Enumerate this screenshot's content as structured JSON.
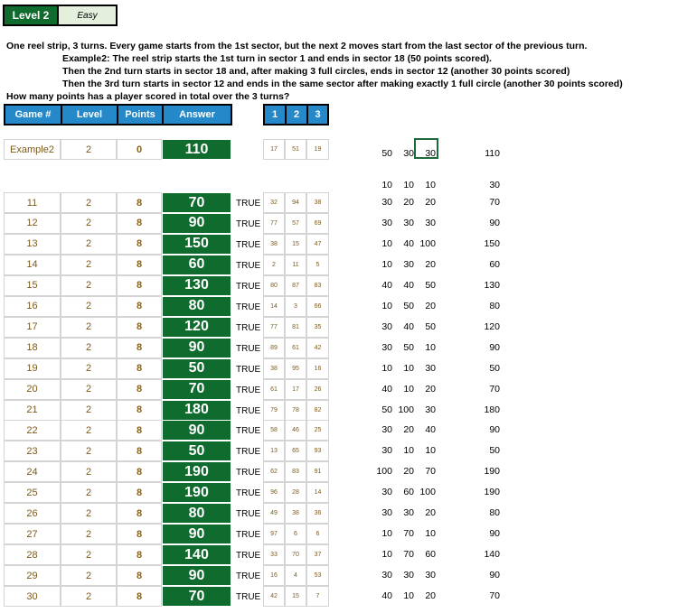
{
  "level": "Level 2",
  "difficulty": "Easy",
  "description": [
    "One reel strip, 3 turns. Every game starts from the 1st sector, but the next 2 moves start from the last sector of the previous turn.",
    "Example2: The reel strip starts the 1st turn in sector 1 and ends in sector 18 (50 points scored).",
    "Then the 2nd turn starts in sector 18 and, after making 3 full circles, ends in sector 12 (another 30 points scored)",
    "Then the 3rd turn starts in sector 12 and ends in the same sector after making exactly 1 full circle (another 30 points scored)",
    "How many points has a player scored in total over the 3 turns?"
  ],
  "headers": {
    "game": "Game #",
    "level": "Level",
    "points": "Points",
    "answer": "Answer",
    "s1": "1",
    "s2": "2",
    "s3": "3"
  },
  "example": {
    "game": "Example2",
    "level": "2",
    "points": "0",
    "answer": "110",
    "sectors": [
      "17",
      "51",
      "19"
    ],
    "calc": [
      "50",
      "30",
      "30"
    ],
    "total": "110"
  },
  "example_sub": {
    "calc": [
      "10",
      "10",
      "10"
    ],
    "total": "30"
  },
  "rows": [
    {
      "game": "11",
      "level": "2",
      "points": "8",
      "answer": "70",
      "check": "TRUE",
      "sectors": [
        "32",
        "94",
        "38"
      ],
      "calc": [
        "30",
        "20",
        "20"
      ],
      "total": "70"
    },
    {
      "game": "12",
      "level": "2",
      "points": "8",
      "answer": "90",
      "check": "TRUE",
      "sectors": [
        "77",
        "57",
        "69"
      ],
      "calc": [
        "30",
        "30",
        "30"
      ],
      "total": "90"
    },
    {
      "game": "13",
      "level": "2",
      "points": "8",
      "answer": "150",
      "check": "TRUE",
      "sectors": [
        "38",
        "15",
        "47"
      ],
      "calc": [
        "10",
        "40",
        "100"
      ],
      "total": "150"
    },
    {
      "game": "14",
      "level": "2",
      "points": "8",
      "answer": "60",
      "check": "TRUE",
      "sectors": [
        "2",
        "11",
        "5"
      ],
      "calc": [
        "10",
        "30",
        "20"
      ],
      "total": "60"
    },
    {
      "game": "15",
      "level": "2",
      "points": "8",
      "answer": "130",
      "check": "TRUE",
      "sectors": [
        "80",
        "87",
        "83"
      ],
      "calc": [
        "40",
        "40",
        "50"
      ],
      "total": "130"
    },
    {
      "game": "16",
      "level": "2",
      "points": "8",
      "answer": "80",
      "check": "TRUE",
      "sectors": [
        "14",
        "3",
        "66"
      ],
      "calc": [
        "10",
        "50",
        "20"
      ],
      "total": "80"
    },
    {
      "game": "17",
      "level": "2",
      "points": "8",
      "answer": "120",
      "check": "TRUE",
      "sectors": [
        "77",
        "81",
        "35"
      ],
      "calc": [
        "30",
        "40",
        "50"
      ],
      "total": "120"
    },
    {
      "game": "18",
      "level": "2",
      "points": "8",
      "answer": "90",
      "check": "TRUE",
      "sectors": [
        "89",
        "61",
        "42"
      ],
      "calc": [
        "30",
        "50",
        "10"
      ],
      "total": "90"
    },
    {
      "game": "19",
      "level": "2",
      "points": "8",
      "answer": "50",
      "check": "TRUE",
      "sectors": [
        "38",
        "95",
        "16"
      ],
      "calc": [
        "10",
        "10",
        "30"
      ],
      "total": "50"
    },
    {
      "game": "20",
      "level": "2",
      "points": "8",
      "answer": "70",
      "check": "TRUE",
      "sectors": [
        "61",
        "17",
        "26"
      ],
      "calc": [
        "40",
        "10",
        "20"
      ],
      "total": "70"
    },
    {
      "game": "21",
      "level": "2",
      "points": "8",
      "answer": "180",
      "check": "TRUE",
      "sectors": [
        "79",
        "78",
        "82"
      ],
      "calc": [
        "50",
        "100",
        "30"
      ],
      "total": "180"
    },
    {
      "game": "22",
      "level": "2",
      "points": "8",
      "answer": "90",
      "check": "TRUE",
      "sectors": [
        "58",
        "46",
        "25"
      ],
      "calc": [
        "30",
        "20",
        "40"
      ],
      "total": "90"
    },
    {
      "game": "23",
      "level": "2",
      "points": "8",
      "answer": "50",
      "check": "TRUE",
      "sectors": [
        "13",
        "65",
        "93"
      ],
      "calc": [
        "30",
        "10",
        "10"
      ],
      "total": "50"
    },
    {
      "game": "24",
      "level": "2",
      "points": "8",
      "answer": "190",
      "check": "TRUE",
      "sectors": [
        "62",
        "83",
        "91"
      ],
      "calc": [
        "100",
        "20",
        "70"
      ],
      "total": "190"
    },
    {
      "game": "25",
      "level": "2",
      "points": "8",
      "answer": "190",
      "check": "TRUE",
      "sectors": [
        "96",
        "28",
        "14"
      ],
      "calc": [
        "30",
        "60",
        "100"
      ],
      "total": "190"
    },
    {
      "game": "26",
      "level": "2",
      "points": "8",
      "answer": "80",
      "check": "TRUE",
      "sectors": [
        "49",
        "38",
        "36"
      ],
      "calc": [
        "30",
        "30",
        "20"
      ],
      "total": "80"
    },
    {
      "game": "27",
      "level": "2",
      "points": "8",
      "answer": "90",
      "check": "TRUE",
      "sectors": [
        "97",
        "6",
        "6"
      ],
      "calc": [
        "10",
        "70",
        "10"
      ],
      "total": "90"
    },
    {
      "game": "28",
      "level": "2",
      "points": "8",
      "answer": "140",
      "check": "TRUE",
      "sectors": [
        "33",
        "70",
        "37"
      ],
      "calc": [
        "10",
        "70",
        "60"
      ],
      "total": "140"
    },
    {
      "game": "29",
      "level": "2",
      "points": "8",
      "answer": "90",
      "check": "TRUE",
      "sectors": [
        "16",
        "4",
        "53"
      ],
      "calc": [
        "30",
        "30",
        "30"
      ],
      "total": "90"
    },
    {
      "game": "30",
      "level": "2",
      "points": "8",
      "answer": "70",
      "check": "TRUE",
      "sectors": [
        "42",
        "15",
        "7"
      ],
      "calc": [
        "40",
        "10",
        "20"
      ],
      "total": "70"
    }
  ]
}
